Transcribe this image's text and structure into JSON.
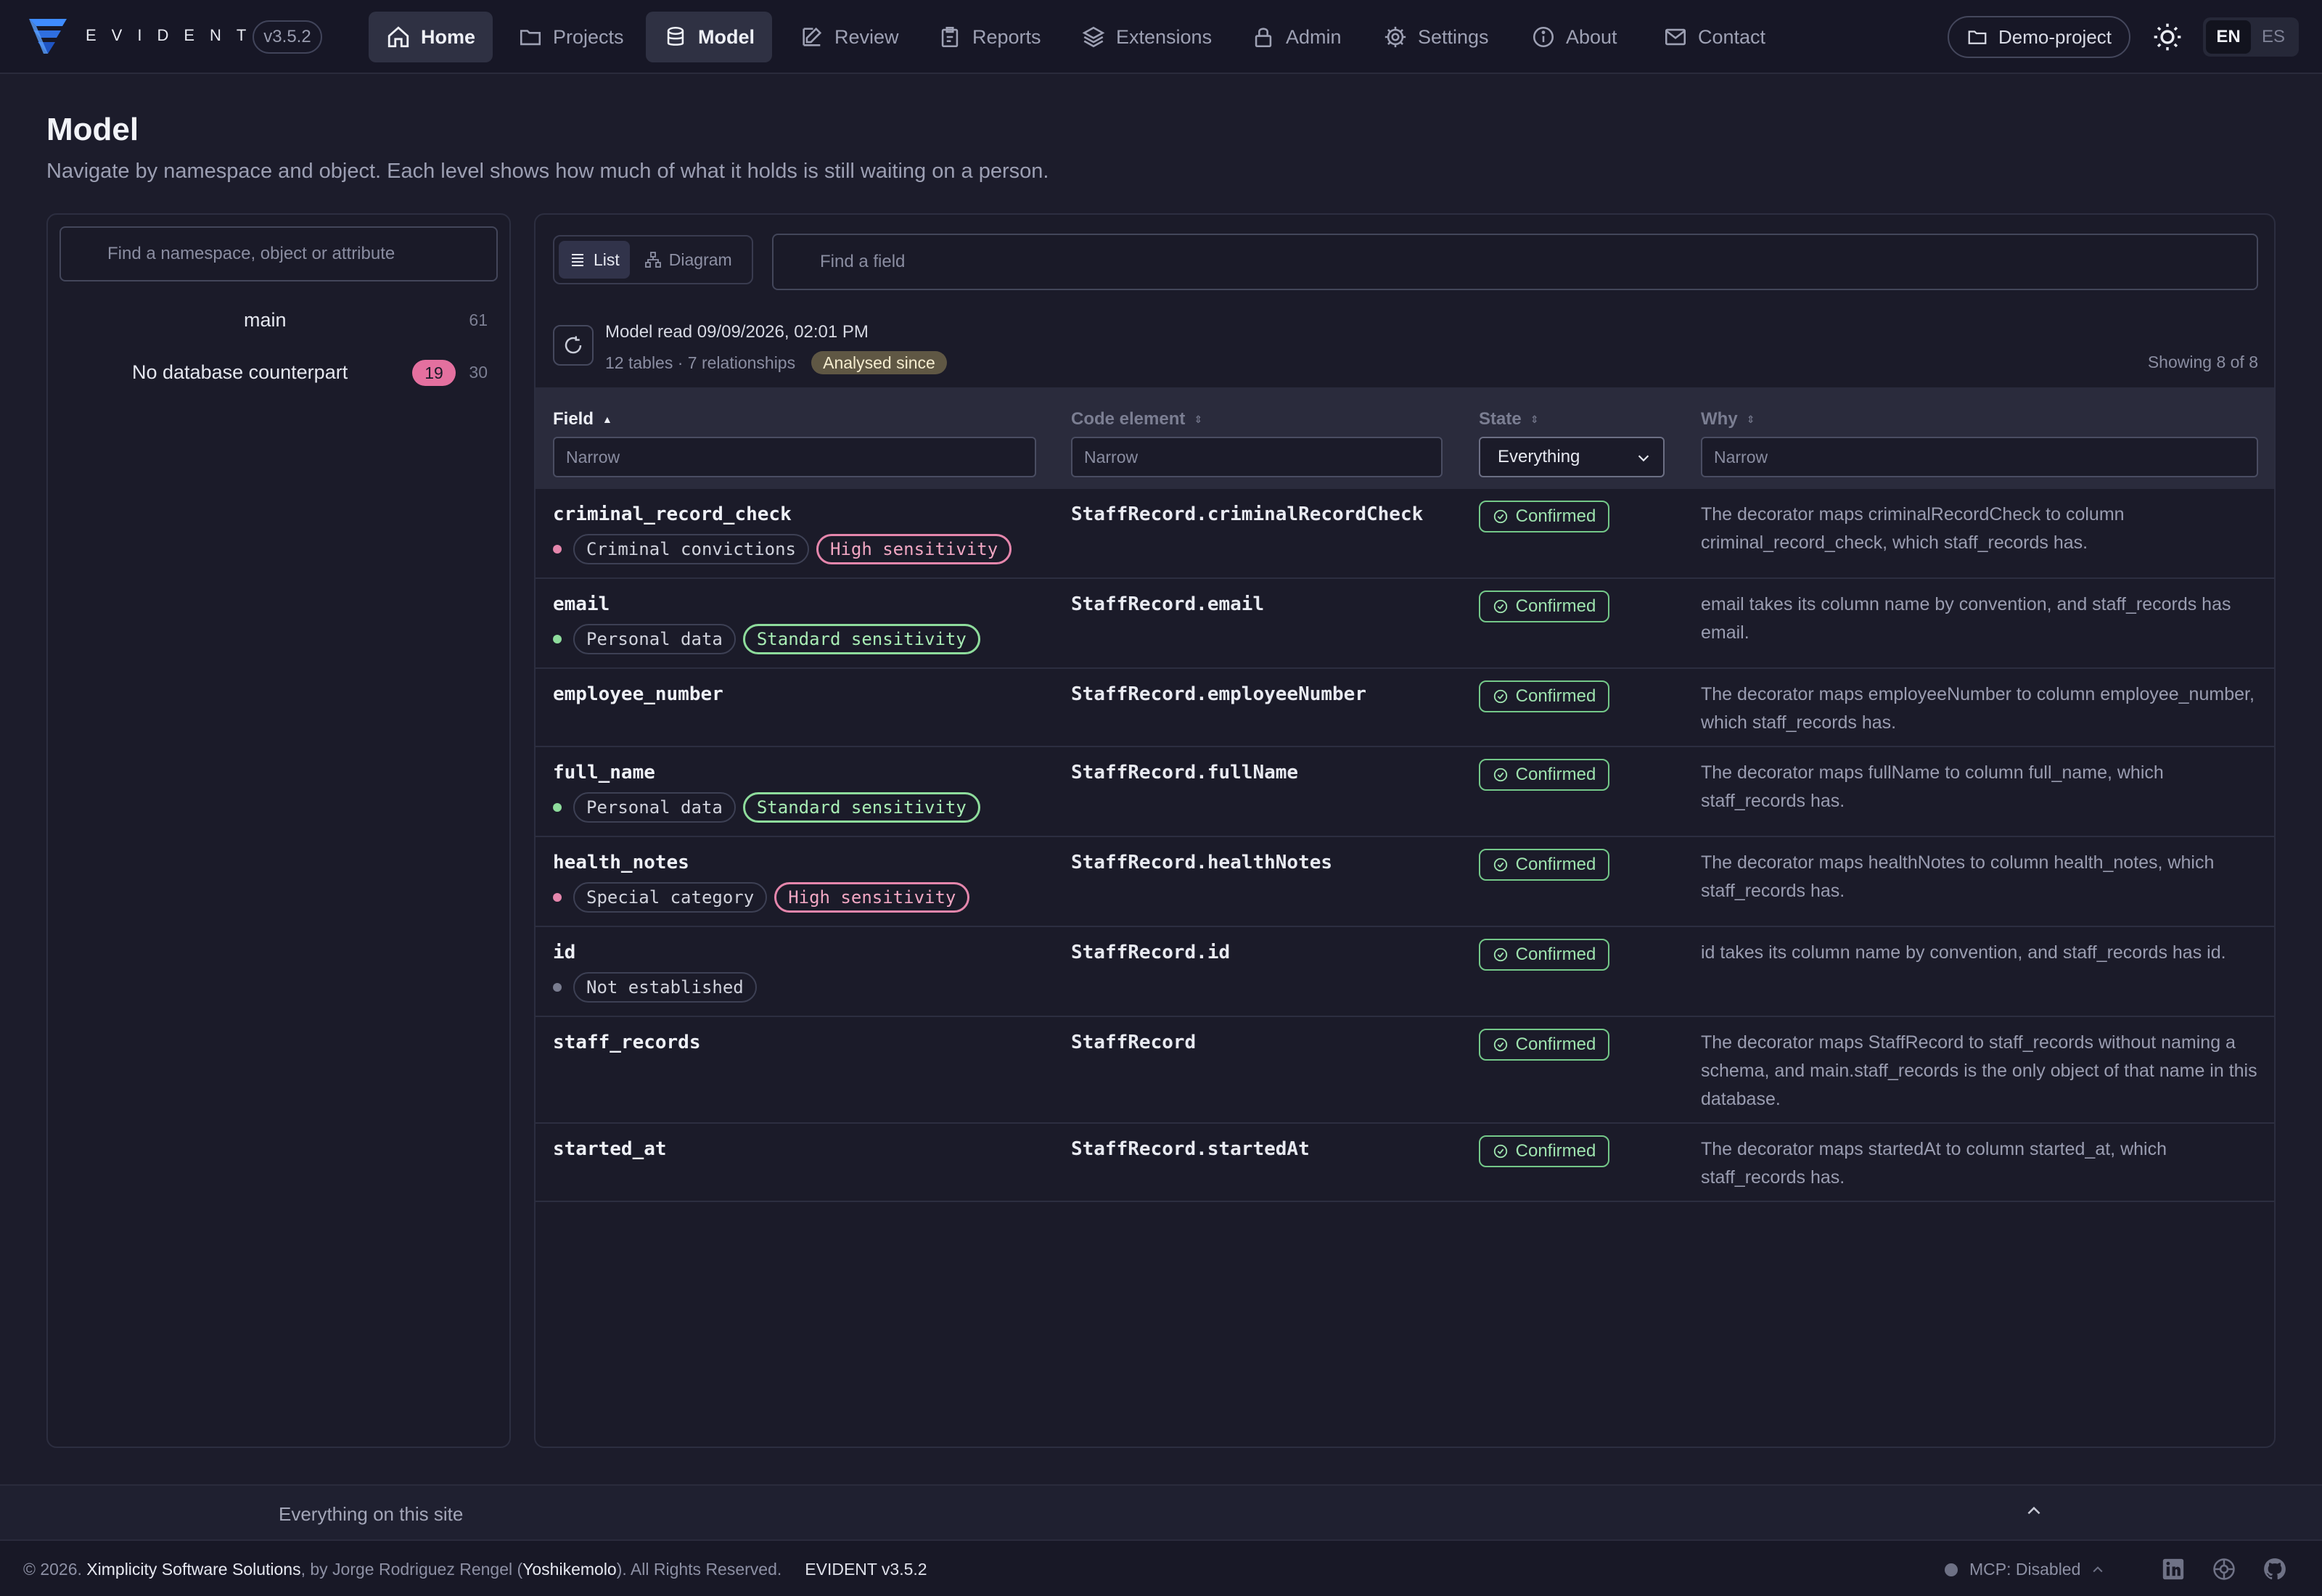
{
  "brand": {
    "name": "EVIDENT",
    "version": "v3.5.2"
  },
  "nav": {
    "items": [
      {
        "label": "Home",
        "icon": "home-icon",
        "active": true
      },
      {
        "label": "Projects",
        "icon": "folder-icon"
      },
      {
        "label": "Model",
        "icon": "database-icon",
        "active": true
      },
      {
        "label": "Review",
        "icon": "edit-icon"
      },
      {
        "label": "Reports",
        "icon": "report-icon"
      },
      {
        "label": "Extensions",
        "icon": "layers-icon"
      },
      {
        "label": "Admin",
        "icon": "lock-icon"
      },
      {
        "label": "Settings",
        "icon": "gear-icon"
      },
      {
        "label": "About",
        "icon": "info-icon"
      },
      {
        "label": "Contact",
        "icon": "mail-icon"
      }
    ],
    "project": "Demo-project",
    "languages": [
      "EN",
      "ES"
    ],
    "active_language": "EN"
  },
  "page": {
    "title": "Model",
    "subtitle": "Navigate by namespace and object. Each level shows how much of what it holds is still waiting on a person."
  },
  "tree": {
    "search_placeholder": "Find a namespace, object or attribute",
    "items": [
      {
        "label": "main",
        "count": "61"
      },
      {
        "label": "No database counterpart",
        "pending": "19",
        "count": "30"
      }
    ]
  },
  "main": {
    "view_list": "List",
    "view_diagram": "Diagram",
    "field_search_placeholder": "Find a field",
    "model_read": "Model read 09/09/2026, 02:01 PM",
    "summary": "12 tables · 7 relationships",
    "analysed_badge": "Analysed since",
    "showing": "Showing 8 of 8",
    "columns": {
      "field": "Field",
      "code": "Code element",
      "state": "State",
      "why": "Why"
    },
    "filters": {
      "field_placeholder": "Narrow",
      "code_placeholder": "Narrow",
      "state_value": "Everything",
      "why_placeholder": "Narrow"
    },
    "rows": [
      {
        "field": "criminal_record_check",
        "category": "Criminal convictions",
        "sensitivity": "High sensitivity",
        "level": "high",
        "code": "StaffRecord.criminalRecordCheck",
        "state": "Confirmed",
        "why": "The decorator maps criminalRecordCheck to column criminal_record_check, which staff_records has."
      },
      {
        "field": "email",
        "category": "Personal data",
        "sensitivity": "Standard sensitivity",
        "level": "standard",
        "code": "StaffRecord.email",
        "state": "Confirmed",
        "why": "email takes its column name by convention, and staff_records has email."
      },
      {
        "field": "employee_number",
        "category": "",
        "sensitivity": "",
        "level": "",
        "code": "StaffRecord.employeeNumber",
        "state": "Confirmed",
        "why": "The decorator maps employeeNumber to column employee_number, which staff_records has."
      },
      {
        "field": "full_name",
        "category": "Personal data",
        "sensitivity": "Standard sensitivity",
        "level": "standard",
        "code": "StaffRecord.fullName",
        "state": "Confirmed",
        "why": "The decorator maps fullName to column full_name, which staff_records has."
      },
      {
        "field": "health_notes",
        "category": "Special category",
        "sensitivity": "High sensitivity",
        "level": "high",
        "code": "StaffRecord.healthNotes",
        "state": "Confirmed",
        "why": "The decorator maps healthNotes to column health_notes, which staff_records has."
      },
      {
        "field": "id",
        "category": "Not established",
        "sensitivity": "",
        "level": "none",
        "code": "StaffRecord.id",
        "state": "Confirmed",
        "why": "id takes its column name by convention, and staff_records has id."
      },
      {
        "field": "staff_records",
        "category": "",
        "sensitivity": "",
        "level": "",
        "code": "StaffRecord",
        "state": "Confirmed",
        "why": "The decorator maps StaffRecord to staff_records without naming a schema, and main.staff_records is the only object of that name in this database."
      },
      {
        "field": "started_at",
        "category": "",
        "sensitivity": "",
        "level": "",
        "code": "StaffRecord.startedAt",
        "state": "Confirmed",
        "why": "The decorator maps startedAt to column started_at, which staff_records has."
      }
    ]
  },
  "footer": {
    "sitemap": "Everything on this site",
    "copyright_prefix": "© 2026.",
    "company": "Ximplicity Software Solutions",
    "by_text": ", by Jorge Rodriguez Rengel (",
    "author": "Yoshikemolo",
    "rights": "). All Rights Reserved.",
    "version": "EVIDENT v3.5.2",
    "mcp": "MCP: Disabled"
  },
  "colors": {
    "accent_blue": "#3b82f6",
    "high": "#e586ac",
    "standard": "#8edc9c",
    "confirmed": "#74c889",
    "pending_badge": "#e4709f"
  }
}
